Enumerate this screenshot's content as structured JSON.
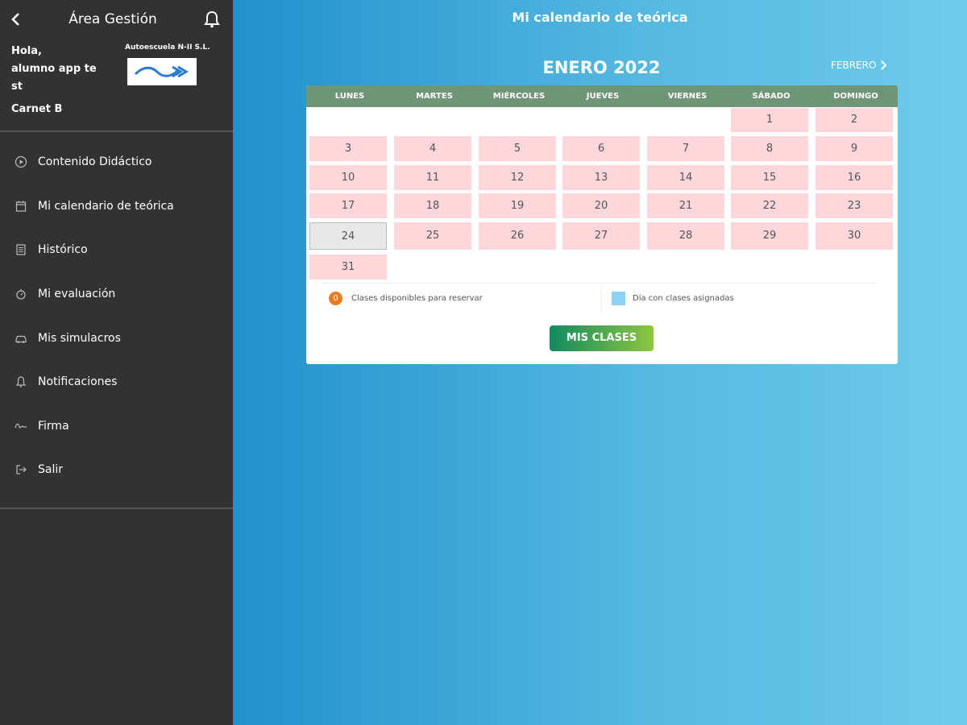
{
  "sidebar": {
    "title": "Área Gestión",
    "greeting": "Hola,",
    "user_line1": "alumno app te",
    "user_line2": "st",
    "school_name": "Autoescuela N-II S.L.",
    "carnet": "Carnet B",
    "menu": [
      {
        "label": "Contenido Didáctico",
        "icon": "play-circle-icon"
      },
      {
        "label": "Mi calendario de teórica",
        "icon": "calendar-icon"
      },
      {
        "label": "Histórico",
        "icon": "history-icon"
      },
      {
        "label": "Mi evaluación",
        "icon": "evaluation-icon"
      },
      {
        "label": "Mis simulacros",
        "icon": "car-icon"
      },
      {
        "label": "Notificaciones",
        "icon": "bell-icon"
      },
      {
        "label": "Firma",
        "icon": "signature-icon"
      },
      {
        "label": "Salir",
        "icon": "logout-icon"
      }
    ]
  },
  "main": {
    "page_title": "Mi calendario de teórica",
    "month_title": "ENERO 2022",
    "next_month": "FEBRERO",
    "weekdays": [
      "LUNES",
      "MARTES",
      "MIÉRCOLES",
      "JUEVES",
      "VIERNES",
      "SÁBADO",
      "DOMINGO"
    ],
    "days": [
      1,
      2,
      3,
      4,
      5,
      6,
      7,
      8,
      9,
      10,
      11,
      12,
      13,
      14,
      15,
      16,
      17,
      18,
      19,
      20,
      21,
      22,
      23,
      24,
      25,
      26,
      27,
      28,
      29,
      30,
      31
    ],
    "today": 24,
    "legend_available_count": "0",
    "legend_available": "Clases disponibles para reservar",
    "legend_assigned": "Día con clases asignadas",
    "mis_clases_button": "MIS CLASES"
  },
  "colors": {
    "sidebar_bg": "#323232",
    "week_header": "#6f9577",
    "day_cell": "#fdd7da",
    "today_cell": "#e8e8e8",
    "legend_available": "#f07a1e",
    "legend_assigned": "#8fd3f4"
  }
}
